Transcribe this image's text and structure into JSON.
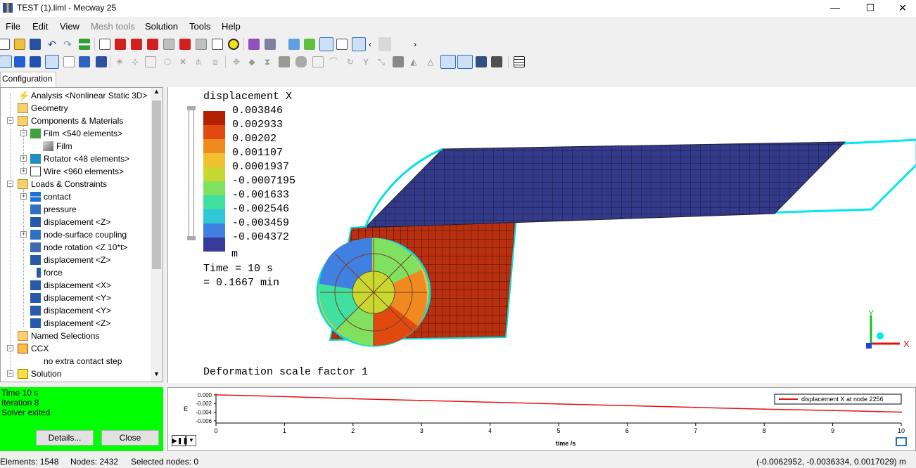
{
  "window": {
    "title": "TEST (1).liml - Mecway 25",
    "minimize": "—",
    "maximize": "☐",
    "close": "✕"
  },
  "menu": [
    "File",
    "Edit",
    "View",
    "Mesh tools",
    "Solution",
    "Tools",
    "Help"
  ],
  "tabs": {
    "configuration": "Configuration"
  },
  "tree": [
    {
      "label": "Analysis <Nonlinear Static 3D>",
      "icon": "lightning-icon",
      "level": 1
    },
    {
      "label": "Geometry",
      "icon": "folder-icon",
      "level": 1
    },
    {
      "label": "Components & Materials",
      "icon": "puzzle-icon",
      "level": 1
    },
    {
      "label": "Film <540 elements>",
      "icon": "puzzle-icon",
      "level": 2
    },
    {
      "label": "Film",
      "icon": "material-icon",
      "level": 3
    },
    {
      "label": "Rotator <48 elements>",
      "icon": "puzzle-icon",
      "level": 2
    },
    {
      "label": "Wire <960 elements>",
      "icon": "puzzle-icon",
      "level": 2
    },
    {
      "label": "Loads & Constraints",
      "icon": "loads-folder-icon",
      "level": 1
    },
    {
      "label": "contact",
      "icon": "contact-icon",
      "level": 2
    },
    {
      "label": "pressure",
      "icon": "pressure-icon",
      "level": 2
    },
    {
      "label": "displacement <Z>",
      "icon": "displacement-icon",
      "level": 2
    },
    {
      "label": "node-surface coupling",
      "icon": "coupling-icon",
      "level": 2
    },
    {
      "label": "node rotation <Z 10*t>",
      "icon": "rotation-icon",
      "level": 2
    },
    {
      "label": "displacement <Z>",
      "icon": "displacement-icon",
      "level": 2
    },
    {
      "label": "force",
      "icon": "force-icon",
      "level": 2
    },
    {
      "label": "displacement <X>",
      "icon": "displacement-icon",
      "level": 2
    },
    {
      "label": "displacement <Y>",
      "icon": "displacement-icon",
      "level": 2
    },
    {
      "label": "displacement <Y>",
      "icon": "displacement-icon",
      "level": 2
    },
    {
      "label": "displacement <Z>",
      "icon": "displacement-icon",
      "level": 2
    },
    {
      "label": "Named Selections",
      "icon": "selection-icon",
      "level": 1
    },
    {
      "label": "CCX",
      "icon": "ccx-icon",
      "level": 1
    },
    {
      "label": "no extra contact step",
      "icon": "",
      "level": 2
    },
    {
      "label": "Solution",
      "icon": "solution-icon",
      "level": 1
    }
  ],
  "solver": {
    "time": "Time 10 s",
    "iteration": "Iteration 8",
    "status": "Solver exited",
    "details_button": "Details...",
    "close_button": "Close"
  },
  "viewport": {
    "legend_title": "displacement X",
    "legend_values": [
      "0.003846",
      "0.002933",
      "0.00202",
      "0.001107",
      "0.0001937",
      "-0.0007195",
      "-0.001633",
      "-0.002546",
      "-0.003459",
      "-0.004372"
    ],
    "legend_colors": [
      "#b22000",
      "#e04a10",
      "#f08a20",
      "#f0c030",
      "#c8d830",
      "#80e060",
      "#40e0a0",
      "#30c8d8",
      "#4080e0",
      "#3a3a9a"
    ],
    "unit": "m",
    "time": "Time = 10 s",
    "time_min": "= 0.1667 min",
    "deformation": "Deformation scale factor 1",
    "axis_x": "X",
    "axis_y": "Y"
  },
  "plot": {
    "y_ticks": [
      "0.000",
      "-0.002",
      "-0.004",
      "-0.006"
    ],
    "y_label": "E",
    "x_ticks": [
      "0",
      "1",
      "2",
      "3",
      "4",
      "5",
      "6",
      "7",
      "8",
      "9",
      "10"
    ],
    "x_label": "time /s",
    "legend": "displacement X at node 2256",
    "line_color": "#e81010"
  },
  "chart_data": {
    "type": "line",
    "x": [
      0,
      1,
      2,
      3,
      4,
      5,
      6,
      7,
      8,
      9,
      10
    ],
    "series": [
      {
        "name": "displacement X at node 2256",
        "values": [
          0.0,
          -0.0004,
          -0.0009,
          -0.0013,
          -0.0017,
          -0.0021,
          -0.0025,
          -0.0029,
          -0.0033,
          -0.0036,
          -0.004
        ]
      }
    ],
    "title": "",
    "xlabel": "time /s",
    "ylabel": "E",
    "xlim": [
      0,
      10
    ],
    "ylim": [
      -0.0065,
      0.0003
    ],
    "grid": false,
    "legend_position": "top-right"
  },
  "statusbar": {
    "elements": "Elements: 1548",
    "nodes": "Nodes: 2432",
    "selected": "Selected nodes: 0",
    "coords": "(-0.0062952, -0.0036334, 0.0017029) m"
  },
  "colors": {
    "panel_green": "#00ff00",
    "accent_cyan": "#00e0e0"
  }
}
